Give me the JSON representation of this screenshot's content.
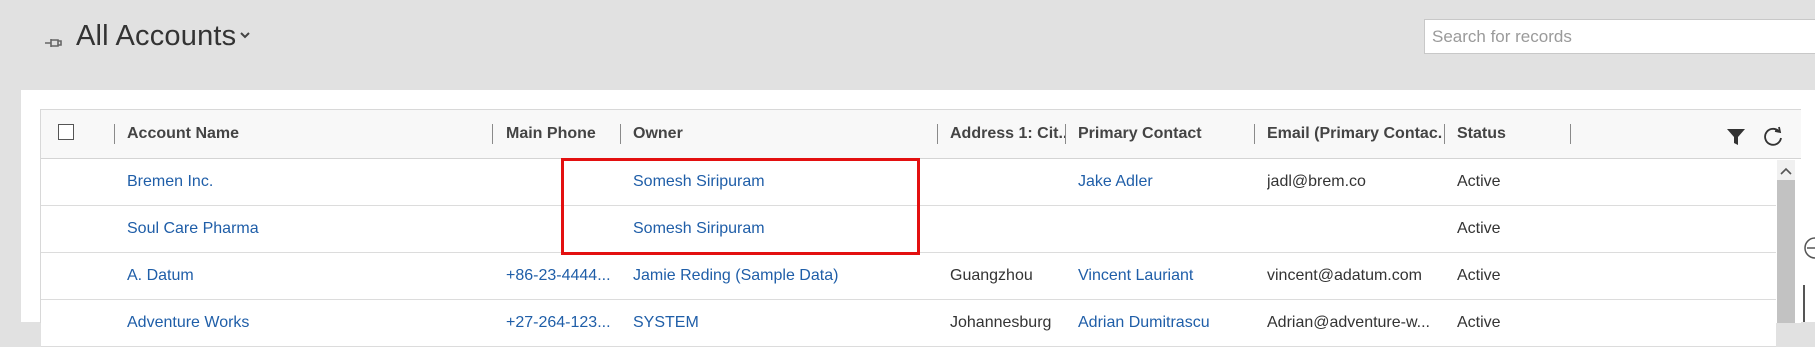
{
  "header": {
    "view_title": "All Accounts",
    "search_placeholder": "Search for records"
  },
  "grid": {
    "columns": [
      "Account Name",
      "Main Phone",
      "Owner",
      "Address 1: Cit...",
      "Primary Contact",
      "Email (Primary Contac...",
      "Status"
    ],
    "rows": [
      {
        "account_name": "Bremen Inc.",
        "main_phone": "",
        "owner": "Somesh Siripuram",
        "city": "",
        "primary_contact": "Jake Adler",
        "email": "jadl@brem.co",
        "status": "Active"
      },
      {
        "account_name": "Soul Care Pharma",
        "main_phone": "",
        "owner": "Somesh Siripuram",
        "city": "",
        "primary_contact": "",
        "email": "",
        "status": "Active"
      },
      {
        "account_name": "A. Datum",
        "main_phone": "+86-23-4444...",
        "owner": "Jamie Reding (Sample Data)",
        "city": "Guangzhou",
        "primary_contact": "Vincent Lauriant",
        "email": "vincent@adatum.com",
        "status": "Active"
      },
      {
        "account_name": "Adventure Works",
        "main_phone": "+27-264-123...",
        "owner": "SYSTEM",
        "city": "Johannesburg",
        "primary_contact": "Adrian Dumitrascu",
        "email": "Adrian@adventure-w...",
        "status": "Active"
      }
    ]
  },
  "icons": {
    "pin": "pin-icon",
    "view_chevron": "chevron-down-icon",
    "filter": "filter-icon",
    "refresh": "refresh-icon"
  },
  "colors": {
    "link": "#1f5ea8",
    "highlight": "#e31010",
    "header_bg": "#e1e1e1"
  }
}
